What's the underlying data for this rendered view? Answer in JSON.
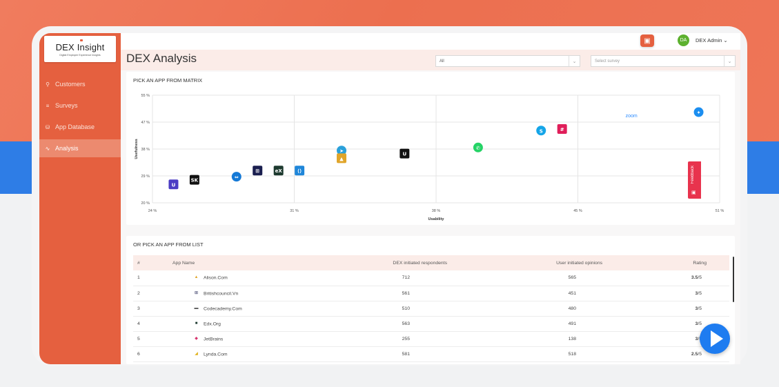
{
  "brand": {
    "logo_title": "DEX Insight",
    "logo_subtitle": "Digital Employee Experience Insights",
    "accent": "#e5603f",
    "band_blue": "#2e7de6"
  },
  "sidebar": {
    "items": [
      {
        "label": "Customers",
        "icon": "person-icon",
        "glyph": "⚲"
      },
      {
        "label": "Surveys",
        "icon": "list-icon",
        "glyph": "≡"
      },
      {
        "label": "App Database",
        "icon": "database-icon",
        "glyph": "⛁"
      },
      {
        "label": "Analysis",
        "icon": "activity-icon",
        "glyph": "∿",
        "active": true
      }
    ]
  },
  "topbar": {
    "user_initials": "DA",
    "user_name": "DEX Admin ⌄"
  },
  "page": {
    "title": "DEX Analysis",
    "filter_value": "All",
    "survey_placeholder": "Select survey",
    "chev": "⌄"
  },
  "matrix": {
    "title": "PICK AN APP FROM MATRIX"
  },
  "list": {
    "title": "OR PICK AN APP FROM LIST",
    "columns": [
      "#",
      "App Name",
      "DEX initiated respondents",
      "User initiated opinions",
      "Rating"
    ],
    "rows": [
      {
        "num": "1",
        "name": "Alison.Com",
        "icon": "alison-icon",
        "glyph": "▲",
        "color": "#e0a52a",
        "dex": "712",
        "user": "565",
        "rating_bold": "3.5",
        "rating_rest": "/5"
      },
      {
        "num": "2",
        "name": "Britishcouncil.Vn",
        "icon": "britishcouncil-icon",
        "glyph": "⊞",
        "color": "#1a1f4f",
        "dex": "561",
        "user": "451",
        "rating_bold": "3",
        "rating_rest": "/5"
      },
      {
        "num": "3",
        "name": "Codecademy.Com",
        "icon": "codecademy-icon",
        "glyph": "▬",
        "color": "#555",
        "dex": "510",
        "user": "480",
        "rating_bold": "3",
        "rating_rest": "/5"
      },
      {
        "num": "4",
        "name": "Edx.Org",
        "icon": "edx-icon",
        "glyph": "■",
        "color": "#1d3a2f",
        "dex": "563",
        "user": "491",
        "rating_bold": "3",
        "rating_rest": "/5"
      },
      {
        "num": "5",
        "name": "JetBrains",
        "icon": "jetbrains-icon",
        "glyph": "◆",
        "color": "#d6336c",
        "dex": "255",
        "user": "138",
        "rating_bold": "3",
        "rating_rest": "/5"
      },
      {
        "num": "6",
        "name": "Lynda.Com",
        "icon": "lynda-icon",
        "glyph": "◢",
        "color": "#e0b21a",
        "dex": "581",
        "user": "518",
        "rating_bold": "2.5",
        "rating_rest": "/5"
      }
    ]
  },
  "feedback_label": "Feedback",
  "chart_data": {
    "type": "scatter",
    "title": "PICK AN APP FROM MATRIX",
    "xlabel": "Usability",
    "ylabel": "Usefulness",
    "x_ticks": [
      "24 %",
      "31 %",
      "38 %",
      "45 %",
      "51 %"
    ],
    "y_ticks": [
      "55 %",
      "47 %",
      "38 %",
      "29 %",
      "20 %"
    ],
    "xlim": [
      24,
      51
    ],
    "ylim": [
      20,
      55
    ],
    "grid": true,
    "points": [
      {
        "app": "Udemy",
        "icon": "udemy-icon",
        "x": 25,
        "y": 26,
        "color": "#4b3cc4",
        "mark": "U"
      },
      {
        "app": "Skillshare",
        "icon": "skillshare-icon",
        "x": 26,
        "y": 27.5,
        "color": "#111111",
        "mark": "SK"
      },
      {
        "app": "TeamViewer",
        "icon": "teamviewer-icon",
        "x": 28,
        "y": 28.5,
        "color": "#1479d6",
        "mark": "⇔"
      },
      {
        "app": "British Council",
        "icon": "britishcouncil-icon",
        "x": 29,
        "y": 30.5,
        "color": "#1a1f4f",
        "mark": "⊞"
      },
      {
        "app": "edX",
        "icon": "edx-icon",
        "x": 30,
        "y": 30.5,
        "color": "#1d3a2f",
        "mark": "eX"
      },
      {
        "app": "VS Code",
        "icon": "vscode-icon",
        "x": 31,
        "y": 30.5,
        "color": "#1f86d9",
        "mark": "⟨⟩"
      },
      {
        "app": "Telegram",
        "icon": "telegram-icon",
        "x": 33,
        "y": 37,
        "color": "#2aa0da",
        "mark": "➤"
      },
      {
        "app": "Alison",
        "icon": "alison-icon",
        "x": 33,
        "y": 34.5,
        "color": "#e0a52a",
        "mark": "▲"
      },
      {
        "app": "Unacademy",
        "icon": "unacademy-icon",
        "x": 36,
        "y": 36,
        "color": "#111111",
        "mark": "U"
      },
      {
        "app": "WhatsApp",
        "icon": "whatsapp-icon",
        "x": 39.5,
        "y": 38,
        "color": "#25d366",
        "mark": "✆"
      },
      {
        "app": "Skype",
        "icon": "skype-icon",
        "x": 42.5,
        "y": 43.5,
        "color": "#15a5e8",
        "mark": "S"
      },
      {
        "app": "Slack",
        "icon": "slack-icon",
        "x": 43.5,
        "y": 44,
        "color": "#e01e5a",
        "mark": "#"
      },
      {
        "app": "Zoom",
        "icon": "zoom-icon",
        "x": 46.8,
        "y": 48.5,
        "color": "#2d8cff",
        "mark": "zoom"
      },
      {
        "app": "Safari",
        "icon": "safari-icon",
        "x": 50,
        "y": 49.5,
        "color": "#1b8ef0",
        "mark": "✦"
      }
    ]
  }
}
